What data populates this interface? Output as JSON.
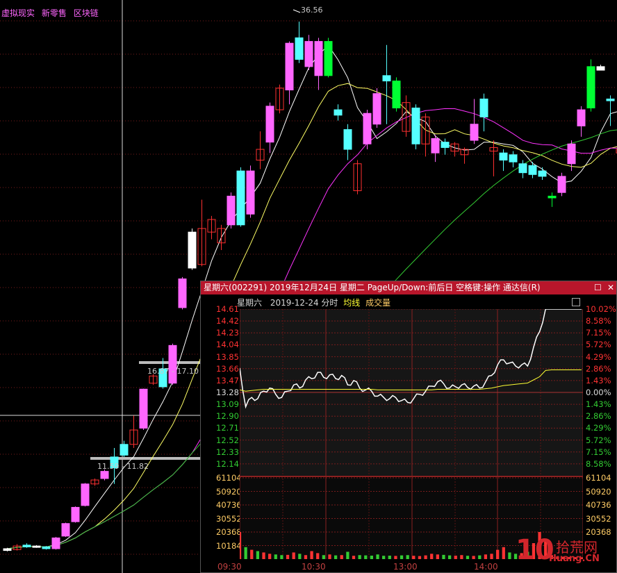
{
  "top_tags": [
    "虚拟现实",
    "新零售",
    "区块链"
  ],
  "kline": {
    "candles": [
      {
        "o": 7.9,
        "c": 8.0,
        "h": 8.05,
        "l": 7.85,
        "col": "w"
      },
      {
        "o": 7.95,
        "c": 8.15,
        "h": 8.25,
        "l": 7.9,
        "col": "r"
      },
      {
        "o": 8.1,
        "c": 8.2,
        "h": 8.3,
        "l": 8.05,
        "col": "c"
      },
      {
        "o": 8.1,
        "c": 8.15,
        "h": 8.2,
        "l": 8.05,
        "col": "w"
      },
      {
        "o": 8.1,
        "c": 8.0,
        "h": 8.15,
        "l": 7.95,
        "col": "c"
      },
      {
        "o": 8.0,
        "c": 8.6,
        "h": 8.65,
        "l": 7.95,
        "col": "m"
      },
      {
        "o": 8.7,
        "c": 9.4,
        "h": 9.45,
        "l": 8.65,
        "col": "m"
      },
      {
        "o": 9.5,
        "c": 10.3,
        "h": 10.35,
        "l": 9.45,
        "col": "m"
      },
      {
        "o": 10.4,
        "c": 11.6,
        "h": 11.65,
        "l": 10.35,
        "col": "m"
      },
      {
        "o": 11.6,
        "c": 11.82,
        "h": 11.9,
        "l": 11.5,
        "col": "r"
      },
      {
        "o": 11.9,
        "c": 12.3,
        "h": 12.4,
        "l": 11.8,
        "col": "m"
      },
      {
        "o": 12.5,
        "c": 13.1,
        "h": 13.6,
        "l": 11.6,
        "col": "c"
      },
      {
        "o": 13.2,
        "c": 13.8,
        "h": 14.0,
        "l": 13.1,
        "col": "c"
      },
      {
        "o": 13.8,
        "c": 14.6,
        "h": 15.4,
        "l": 13.6,
        "col": "r"
      },
      {
        "o": 14.7,
        "c": 16.87,
        "h": 16.9,
        "l": 14.6,
        "col": "m"
      },
      {
        "o": 17.2,
        "c": 17.6,
        "h": 17.7,
        "l": 17.1,
        "col": "r"
      },
      {
        "o": 17.0,
        "c": 18.0,
        "h": 18.6,
        "l": 16.9,
        "col": "c"
      },
      {
        "o": 17.2,
        "c": 19.3,
        "h": 19.4,
        "l": 17.1,
        "col": "m"
      },
      {
        "o": 21.4,
        "c": 23.0,
        "h": 23.1,
        "l": 21.3,
        "col": "m"
      },
      {
        "o": 23.6,
        "c": 25.6,
        "h": 25.8,
        "l": 23.5,
        "col": "w"
      },
      {
        "o": 23.8,
        "c": 25.8,
        "h": 27.4,
        "l": 23.7,
        "col": "r"
      },
      {
        "o": 25.6,
        "c": 26.3,
        "h": 26.5,
        "l": 25.2,
        "col": "r"
      },
      {
        "o": 25.0,
        "c": 25.8,
        "h": 26.0,
        "l": 24.6,
        "col": "r"
      },
      {
        "o": 26.0,
        "c": 27.6,
        "h": 27.8,
        "l": 25.8,
        "col": "m"
      },
      {
        "o": 26.0,
        "c": 29.0,
        "h": 29.2,
        "l": 25.9,
        "col": "c"
      },
      {
        "o": 26.6,
        "c": 29.0,
        "h": 29.3,
        "l": 26.4,
        "col": "m"
      },
      {
        "o": 29.6,
        "c": 30.2,
        "h": 31.2,
        "l": 29.1,
        "col": "r"
      },
      {
        "o": 30.6,
        "c": 32.6,
        "h": 32.8,
        "l": 30.0,
        "col": "m"
      },
      {
        "o": 32.4,
        "c": 33.6,
        "h": 33.8,
        "l": 32.2,
        "col": "r"
      },
      {
        "o": 33.5,
        "c": 36.1,
        "h": 36.2,
        "l": 32.7,
        "col": "m"
      },
      {
        "o": 36.4,
        "c": 35.2,
        "h": 37.3,
        "l": 35.0,
        "col": "c"
      },
      {
        "o": 34.8,
        "c": 36.2,
        "h": 36.56,
        "l": 34.6,
        "col": "m"
      },
      {
        "o": 34.3,
        "c": 36.2,
        "h": 36.4,
        "l": 33.5,
        "col": "m"
      },
      {
        "o": 34.3,
        "c": 36.2,
        "h": 36.4,
        "l": 34.2,
        "col": "g"
      },
      {
        "o": 32.4,
        "c": 32.1,
        "h": 32.7,
        "l": 31.8,
        "col": "c"
      },
      {
        "o": 31.3,
        "c": 30.2,
        "h": 31.6,
        "l": 29.6,
        "col": "c"
      },
      {
        "o": 29.4,
        "c": 27.9,
        "h": 29.6,
        "l": 27.7,
        "col": "r"
      },
      {
        "o": 30.5,
        "c": 32.2,
        "h": 32.4,
        "l": 30.2,
        "col": "m"
      },
      {
        "o": 33.3,
        "c": 31.6,
        "h": 33.6,
        "l": 31.4,
        "col": "m"
      },
      {
        "o": 34.3,
        "c": 34.0,
        "h": 36.0,
        "l": 31.6,
        "col": "c"
      },
      {
        "o": 34.0,
        "c": 32.5,
        "h": 34.2,
        "l": 32.3,
        "col": "g"
      },
      {
        "o": 32.8,
        "c": 31.2,
        "h": 33.2,
        "l": 30.9,
        "col": "r"
      },
      {
        "o": 32.5,
        "c": 30.5,
        "h": 32.7,
        "l": 30.2,
        "col": "c"
      },
      {
        "o": 32.0,
        "c": 30.5,
        "h": 32.2,
        "l": 29.8,
        "col": "r"
      },
      {
        "o": 30.8,
        "c": 30.0,
        "h": 31.0,
        "l": 29.5,
        "col": "m"
      },
      {
        "o": 30.6,
        "c": 30.3,
        "h": 30.8,
        "l": 29.9,
        "col": "c"
      },
      {
        "o": 30.5,
        "c": 30.1,
        "h": 30.6,
        "l": 29.8,
        "col": "r"
      },
      {
        "o": 30.2,
        "c": 29.9,
        "h": 30.3,
        "l": 29.4,
        "col": "r"
      },
      {
        "o": 31.6,
        "c": 30.7,
        "h": 33.0,
        "l": 30.5,
        "col": "m"
      },
      {
        "o": 33.0,
        "c": 32.0,
        "h": 33.3,
        "l": 31.2,
        "col": "c"
      },
      {
        "o": 30.1,
        "c": 30.3,
        "h": 30.7,
        "l": 28.7,
        "col": "r"
      },
      {
        "o": 30.0,
        "c": 29.6,
        "h": 30.2,
        "l": 29.0,
        "col": "c"
      },
      {
        "o": 29.9,
        "c": 29.5,
        "h": 30.1,
        "l": 29.2,
        "col": "c"
      },
      {
        "o": 29.4,
        "c": 28.9,
        "h": 29.6,
        "l": 28.6,
        "col": "c"
      },
      {
        "o": 29.3,
        "c": 28.8,
        "h": 29.5,
        "l": 28.6,
        "col": "c"
      },
      {
        "o": 29.0,
        "c": 28.7,
        "h": 29.2,
        "l": 28.5,
        "col": "c"
      },
      {
        "o": 27.6,
        "c": 27.5,
        "h": 27.8,
        "l": 27.0,
        "col": "g"
      },
      {
        "o": 28.7,
        "c": 27.8,
        "h": 28.9,
        "l": 27.6,
        "col": "m"
      },
      {
        "o": 30.5,
        "c": 29.4,
        "h": 30.7,
        "l": 29.0,
        "col": "m"
      },
      {
        "o": 32.4,
        "c": 31.5,
        "h": 32.6,
        "l": 30.9,
        "col": "m"
      },
      {
        "o": 34.8,
        "c": 32.5,
        "h": 35.2,
        "l": 32.3,
        "col": "g"
      },
      {
        "o": 34.8,
        "c": 34.6,
        "h": 34.9,
        "l": 34.6,
        "col": "w"
      },
      {
        "o": 33.0,
        "c": 32.9,
        "h": 33.2,
        "l": 31.5,
        "col": "c"
      },
      {
        "o": 30.0,
        "c": 30.2,
        "h": 30.6,
        "l": 29.1,
        "col": "r"
      },
      {
        "o": 30.0,
        "c": 30.0,
        "h": 31.4,
        "l": 29.6,
        "col": "c"
      }
    ],
    "peak_label": "36.56",
    "box_label_upper": "16.87 - 17.10",
    "box_label_lower": "11.59 - 11.82"
  },
  "popup": {
    "title": "星期六(002291) 2019年12月24日 星期二 PageUp/Down:前后日 空格键:操作 通达信(R)",
    "btn_max": "☐",
    "btn_close": "✕",
    "sub_name": "星期六",
    "sub_date": "2019-12-24 分时",
    "sub_avg": "均线",
    "sub_vol": "成交量",
    "price_labels": [
      "14.61",
      "14.42",
      "14.23",
      "14.04",
      "13.85",
      "13.66",
      "13.47",
      "13.28",
      "13.09",
      "12.90",
      "12.71",
      "12.52",
      "12.33",
      "12.14"
    ],
    "pct_labels": [
      "10.02%",
      "8.58%",
      "7.15%",
      "5.72%",
      "4.29%",
      "2.86%",
      "1.43%",
      "0.00%",
      "1.43%",
      "2.86%",
      "4.29%",
      "5.72%",
      "7.15%",
      "8.58%"
    ],
    "vol_labels": [
      "61104",
      "50920",
      "40736",
      "30552",
      "20368",
      "10184"
    ],
    "vol_labels_r": [
      "61104",
      "50920",
      "40736",
      "30552",
      "20368"
    ],
    "time_labels": [
      "09:30",
      "10:30",
      "13:00",
      "14:00"
    ],
    "prev_close": 13.28,
    "limit_up": 14.61,
    "price_series": [
      13.67,
      13.05,
      13.2,
      13.18,
      13.3,
      13.35,
      13.25,
      13.2,
      13.3,
      13.4,
      13.35,
      13.48,
      13.5,
      13.6,
      13.52,
      13.56,
      13.5,
      13.55,
      13.4,
      13.47,
      13.35,
      13.32,
      13.3,
      13.22,
      13.2,
      13.18,
      13.2,
      13.15,
      13.12,
      13.18,
      13.25,
      13.3,
      13.38,
      13.45,
      13.42,
      13.35,
      13.37,
      13.4,
      13.36,
      13.38,
      13.35,
      13.45,
      13.55,
      13.72,
      13.8,
      13.75,
      13.7,
      13.72,
      13.7,
      14.0,
      14.25,
      14.61,
      14.61,
      14.61,
      14.61,
      14.61,
      14.61,
      14.61
    ],
    "avg_series": [
      13.32,
      13.3,
      13.31,
      13.32,
      13.33,
      13.33,
      13.33,
      13.33,
      13.33,
      13.33,
      13.33,
      13.33,
      13.33,
      13.33,
      13.33,
      13.33,
      13.33,
      13.33,
      13.33,
      13.33,
      13.33,
      13.33,
      13.33,
      13.32,
      13.32,
      13.32,
      13.32,
      13.32,
      13.32,
      13.32,
      13.32,
      13.32,
      13.32,
      13.33,
      13.33,
      13.33,
      13.33,
      13.33,
      13.33,
      13.33,
      13.33,
      13.34,
      13.35,
      13.37,
      13.39,
      13.4,
      13.41,
      13.42,
      13.43,
      13.48,
      13.53,
      13.63,
      13.64,
      13.64,
      13.64,
      13.64,
      13.64,
      13.64
    ],
    "volume_series": [
      20368,
      9000,
      7000,
      6000,
      5000,
      4000,
      3500,
      3000,
      3200,
      5000,
      4000,
      3000,
      6000,
      4500,
      3000,
      3500,
      2800,
      3000,
      5500,
      2500,
      3000,
      2800,
      2600,
      3500,
      2500,
      2600,
      2400,
      2800,
      3000,
      2500,
      2300,
      2800,
      4000,
      3500,
      3200,
      2800,
      2600,
      3000,
      2500,
      2400,
      2800,
      3500,
      4000,
      7000,
      9000,
      5000,
      4000,
      4500,
      5500,
      12000,
      20368,
      15000,
      3000,
      2000,
      1800,
      1600,
      1500,
      1400
    ],
    "colors": {
      "up": "#ff3333",
      "down": "#33cc33",
      "flat": "#dddddd",
      "avg": "#ffff33",
      "grid": "#7a1c1c"
    }
  },
  "watermark": {
    "ten": "10",
    "cn": "拾荒网",
    "url": "Huang.CN"
  }
}
